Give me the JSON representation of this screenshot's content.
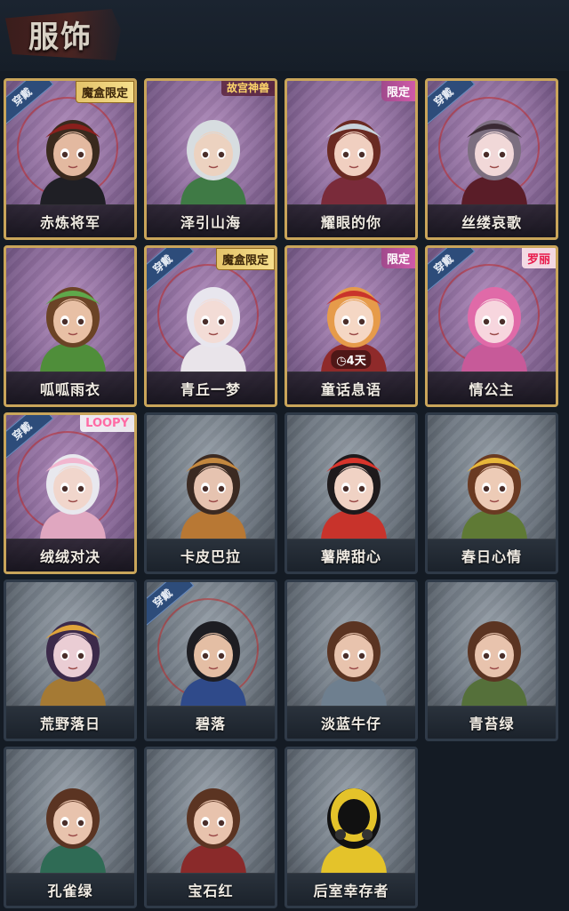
{
  "header": {
    "title": "服饰"
  },
  "wear_label": "穿戴",
  "cards": [
    {
      "name": "赤炼将军",
      "rarity": "purple",
      "worn": true,
      "corner": "魔盒限定",
      "corner_type": "box",
      "hair": "#3a2a1e",
      "hat": "#8a1f1c",
      "skin": "#e3b9a0",
      "outfit": "#1f1f25"
    },
    {
      "name": "泽引山海",
      "rarity": "purple",
      "worn": false,
      "corner": "故宫神兽",
      "corner_type": "collab",
      "hair": "#d7dde0",
      "hat": "",
      "skin": "#ecd2c0",
      "outfit": "#3f7a45"
    },
    {
      "name": "耀眼的你",
      "rarity": "purple",
      "worn": false,
      "corner": "限定",
      "corner_type": "limited",
      "hair": "#6a2a22",
      "hat": "#c9d3dc",
      "skin": "#f0cfc0",
      "outfit": "#7a2b3a"
    },
    {
      "name": "丝缕哀歌",
      "rarity": "purple",
      "worn": true,
      "corner": "",
      "corner_type": "",
      "hair": "#7c6f80",
      "hat": "#3a2a34",
      "skin": "#f1d8d8",
      "outfit": "#5a1d28"
    },
    {
      "name": "呱呱雨衣",
      "rarity": "purple",
      "worn": false,
      "corner": "",
      "corner_type": "",
      "hair": "#6b4326",
      "hat": "#5fa84b",
      "skin": "#e8c0a5",
      "outfit": "#4f8e3a"
    },
    {
      "name": "青丘一梦",
      "rarity": "purple",
      "worn": true,
      "corner": "魔盒限定",
      "corner_type": "box",
      "hair": "#e8e6ee",
      "hat": "",
      "skin": "#f3dcd6",
      "outfit": "#e9e4ea"
    },
    {
      "name": "童话息语",
      "rarity": "purple",
      "worn": false,
      "corner": "限定",
      "corner_type": "limited",
      "hair": "#e69b4a",
      "hat": "#c9342b",
      "skin": "#f5d7c4",
      "outfit": "#8f2a2a",
      "timer": "4天"
    },
    {
      "name": "情公主",
      "rarity": "purple",
      "worn": true,
      "corner": "罗丽",
      "corner_type": "lolita",
      "hair": "#e06aa8",
      "hat": "",
      "skin": "#f7d6de",
      "outfit": "#c75a99"
    },
    {
      "name": "绒绒对决",
      "rarity": "purple",
      "worn": true,
      "corner": "LOOPY",
      "corner_type": "loopy",
      "hair": "#e8e8ee",
      "hat": "#f2b6cf",
      "skin": "#f1d6cc",
      "outfit": "#e0a7c0"
    },
    {
      "name": "卡皮巴拉",
      "rarity": "gray",
      "worn": false,
      "corner": "",
      "corner_type": "",
      "hair": "#3b2a22",
      "hat": "#c4883f",
      "skin": "#e6c3b0",
      "outfit": "#b87834"
    },
    {
      "name": "薯牌甜心",
      "rarity": "gray",
      "worn": false,
      "corner": "",
      "corner_type": "",
      "hair": "#1e1a1c",
      "hat": "#d8342b",
      "skin": "#f0d2c4",
      "outfit": "#c8332b"
    },
    {
      "name": "春日心情",
      "rarity": "gray",
      "worn": false,
      "corner": "",
      "corner_type": "",
      "hair": "#6a3a22",
      "hat": "#e8b73a",
      "skin": "#edcbb6",
      "outfit": "#5f7a35"
    },
    {
      "name": "荒野落日",
      "rarity": "gray",
      "worn": false,
      "corner": "",
      "corner_type": "",
      "hair": "#3c2a4a",
      "hat": "#e0a43a",
      "skin": "#eacdd4",
      "outfit": "#a57a34"
    },
    {
      "name": "碧落",
      "rarity": "gray",
      "worn": true,
      "corner": "",
      "corner_type": "",
      "hair": "#1d1d22",
      "hat": "",
      "skin": "#e4bea4",
      "outfit": "#2f4a8a"
    },
    {
      "name": "淡蓝牛仔",
      "rarity": "gray",
      "worn": false,
      "corner": "",
      "corner_type": "",
      "hair": "#5b3422",
      "hat": "",
      "skin": "#e8c3ad",
      "outfit": "#6e7f8f"
    },
    {
      "name": "青苔绿",
      "rarity": "gray",
      "worn": false,
      "corner": "",
      "corner_type": "",
      "hair": "#5b3422",
      "hat": "",
      "skin": "#e8c3ad",
      "outfit": "#55703a"
    },
    {
      "name": "孔雀绿",
      "rarity": "gray",
      "worn": false,
      "corner": "",
      "corner_type": "",
      "hair": "#5b3422",
      "hat": "",
      "skin": "#e8c3ad",
      "outfit": "#2f6b55"
    },
    {
      "name": "宝石红",
      "rarity": "gray",
      "worn": false,
      "corner": "",
      "corner_type": "",
      "hair": "#5b3422",
      "hat": "",
      "skin": "#e8c3ad",
      "outfit": "#8a2a2a"
    },
    {
      "name": "后室幸存者",
      "rarity": "gray",
      "worn": false,
      "corner": "",
      "corner_type": "",
      "hair": "#111111",
      "hat": "#e4c32a",
      "skin": "#1a1a1a",
      "outfit": "#e4c32a",
      "mask": true
    }
  ]
}
